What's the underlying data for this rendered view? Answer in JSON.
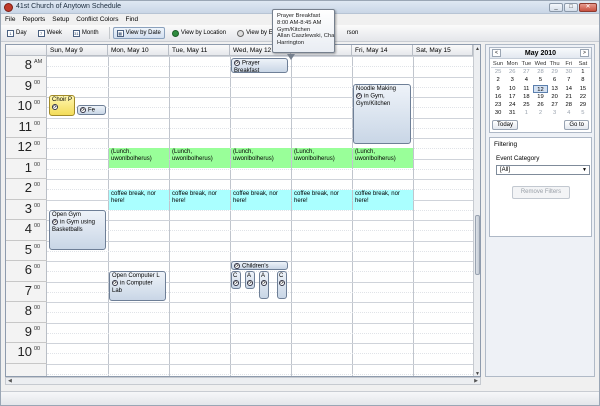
{
  "window": {
    "title": "41st Church of Anytown Schedule",
    "minimize": "_",
    "restore": "□",
    "close": "✕"
  },
  "menu": [
    "File",
    "Reports",
    "Setup",
    "Conflict Colors",
    "Find"
  ],
  "toolbar": {
    "day": "Day",
    "week": "Week",
    "month": "Month",
    "by_date": "View by Date",
    "by_location": "View by Location",
    "by_event": "View by Ev",
    "tail": "rson"
  },
  "days": [
    "Sun, May 9",
    "Mon, May 10",
    "Tue, May 11",
    "Wed, May 12",
    "",
    "Fri, May 14",
    "Sat, May 15"
  ],
  "hours": [
    {
      "n": "8",
      "m": "AM"
    },
    {
      "n": "9",
      "m": "00"
    },
    {
      "n": "10",
      "m": "00"
    },
    {
      "n": "11",
      "m": "00"
    },
    {
      "n": "12",
      "m": "00"
    },
    {
      "n": "1",
      "m": "00"
    },
    {
      "n": "2",
      "m": "00"
    },
    {
      "n": "3",
      "m": "00"
    },
    {
      "n": "4",
      "m": "00"
    },
    {
      "n": "5",
      "m": "00"
    },
    {
      "n": "6",
      "m": "00"
    },
    {
      "n": "7",
      "m": "00"
    },
    {
      "n": "8",
      "m": "00"
    },
    {
      "n": "9",
      "m": "00"
    },
    {
      "n": "10",
      "m": "00"
    }
  ],
  "events": {
    "prayer": "Prayer Breakfast",
    "choir": "Choir P",
    "fe": "Fe",
    "noodle_title": "Noodle Making",
    "noodle_loc": "in Gym, Gym/Kitchen",
    "lunch": "(Lunch, uwonlbolherus)",
    "coffee": "coffee break, nor here!",
    "opengym_title": "Open Gym",
    "opengym_loc": "in Gym using Basketballs",
    "children": "Children's",
    "opencomp_title": "Open Computer L",
    "opencomp_loc": "in Computer Lab",
    "mini_letters": [
      "C",
      "A",
      "A",
      "C"
    ]
  },
  "tooltip": {
    "lines": [
      "Prayer Breakfast",
      "8:00 AM-8:45 AM",
      "Gym/Kitchen",
      "Allan Caszlewski, Cha",
      "Harrington"
    ]
  },
  "calendar": {
    "month_label": "May 2010",
    "prev": "<",
    "next": ">",
    "day_names": [
      "Sun",
      "Mon",
      "Tue",
      "Wed",
      "Thu",
      "Fri",
      "Sat"
    ],
    "weeks": [
      [
        "25",
        "26",
        "27",
        "28",
        "29",
        "30",
        "1"
      ],
      [
        "2",
        "3",
        "4",
        "5",
        "6",
        "7",
        "8"
      ],
      [
        "9",
        "10",
        "11",
        "12",
        "13",
        "14",
        "15"
      ],
      [
        "16",
        "17",
        "18",
        "19",
        "20",
        "21",
        "22"
      ],
      [
        "23",
        "24",
        "25",
        "26",
        "27",
        "28",
        "29"
      ],
      [
        "30",
        "31",
        "1",
        "2",
        "3",
        "4",
        "5"
      ]
    ],
    "today_button": "Today",
    "goto_button": "Go to"
  },
  "filtering": {
    "title": "Filtering",
    "category_label": "Event Category",
    "category_value": "[All]",
    "remove_button": "Remove Filters"
  }
}
